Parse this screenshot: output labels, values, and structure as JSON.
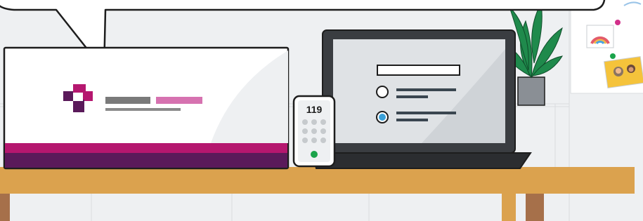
{
  "phone": {
    "number": "119",
    "led_color": "#1aa34a"
  },
  "banner": {
    "stripe_colors": [
      "#b5176f",
      "#5a1a5a"
    ],
    "logo_colors": [
      "#5a1a5a",
      "#b5176f"
    ],
    "text_bar_colors": [
      "#7a7a7a",
      "#d672b0",
      "#8a8a8a"
    ]
  },
  "laptop": {
    "form": {
      "input_field": "",
      "options": [
        {
          "selected": false
        },
        {
          "selected": true
        }
      ],
      "selected_color": "#3aa0d8"
    }
  },
  "wall_board": {
    "items": [
      "rainbow-icon",
      "family-photo-icon"
    ]
  },
  "colors": {
    "desk": "#dba24e",
    "desk_legs": "#a6704a",
    "wall": "#eef0f2",
    "outline": "#1d1d1d"
  }
}
